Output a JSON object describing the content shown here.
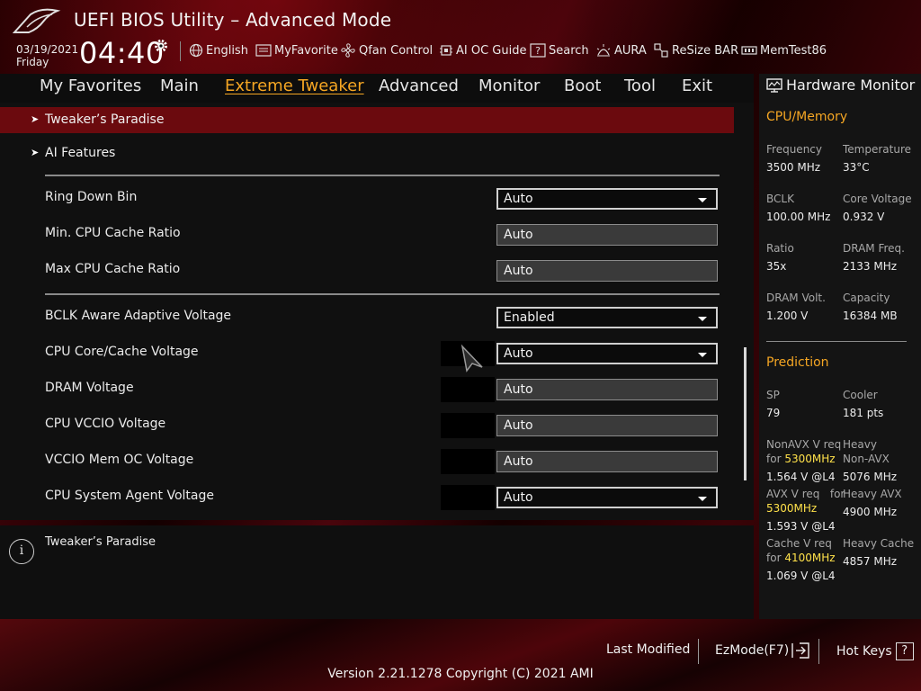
{
  "header": {
    "app_title": "UEFI BIOS Utility – Advanced Mode",
    "date": "03/19/2021",
    "day": "Friday",
    "time": "04:40",
    "tools": [
      {
        "label": "English",
        "icon": "globe-icon"
      },
      {
        "label": "MyFavorite",
        "icon": "favorite-icon"
      },
      {
        "label": "Qfan Control",
        "icon": "fan-icon"
      },
      {
        "label": "AI OC Guide",
        "icon": "ai-chip-icon"
      },
      {
        "label": "Search",
        "icon": "search-help-icon"
      },
      {
        "label": "AURA",
        "icon": "aura-icon"
      },
      {
        "label": "ReSize BAR",
        "icon": "resize-bar-icon"
      },
      {
        "label": "MemTest86",
        "icon": "memory-icon"
      }
    ]
  },
  "tabs": [
    {
      "label": "My Favorites",
      "active": false
    },
    {
      "label": "Main",
      "active": false
    },
    {
      "label": "Extreme Tweaker",
      "active": true
    },
    {
      "label": "Advanced",
      "active": false
    },
    {
      "label": "Monitor",
      "active": false
    },
    {
      "label": "Boot",
      "active": false
    },
    {
      "label": "Tool",
      "active": false
    },
    {
      "label": "Exit",
      "active": false
    }
  ],
  "sections": [
    {
      "label": "Tweaker’s Paradise",
      "highlighted": true
    },
    {
      "label": "AI Features",
      "highlighted": false
    }
  ],
  "settings": [
    {
      "label": "Ring Down Bin",
      "value": "Auto",
      "type": "dropdown"
    },
    {
      "label": "Min. CPU Cache Ratio",
      "value": "Auto",
      "type": "text"
    },
    {
      "label": "Max CPU Cache Ratio",
      "value": "Auto",
      "type": "text"
    },
    {
      "label": "BCLK Aware Adaptive Voltage",
      "value": "Enabled",
      "type": "dropdown"
    },
    {
      "label": "CPU Core/Cache Voltage",
      "value": "Auto",
      "type": "dropdown"
    },
    {
      "label": "DRAM Voltage",
      "value": "Auto",
      "type": "text"
    },
    {
      "label": "CPU VCCIO Voltage",
      "value": "Auto",
      "type": "text"
    },
    {
      "label": "VCCIO Mem OC Voltage",
      "value": "Auto",
      "type": "text"
    },
    {
      "label": "CPU System Agent Voltage",
      "value": "Auto",
      "type": "dropdown"
    }
  ],
  "help": {
    "text": "Tweaker’s Paradise"
  },
  "hw": {
    "title": "Hardware Monitor",
    "cpu_head": "CPU/Memory",
    "cpu": [
      {
        "label": "Frequency",
        "value": "3500 MHz"
      },
      {
        "label": "Temperature",
        "value": "33°C"
      },
      {
        "label": "BCLK",
        "value": "100.00 MHz"
      },
      {
        "label": "Core Voltage",
        "value": "0.932 V"
      },
      {
        "label": "Ratio",
        "value": "35x"
      },
      {
        "label": "DRAM Freq.",
        "value": "2133 MHz"
      },
      {
        "label": "DRAM Volt.",
        "value": "1.200 V"
      },
      {
        "label": "Capacity",
        "value": "16384 MB"
      }
    ],
    "pred_head": "Prediction",
    "sp_label": "SP",
    "sp_value": "79",
    "cooler_label": "Cooler",
    "cooler_value": "181 pts",
    "nonavx_label_a": "NonAVX V req",
    "nonavx_label_b": "for",
    "nonavx_freq": "5300MHz",
    "nonavx_value": "1.564 V @L4",
    "heavy_nonavx_label_a": "Heavy",
    "heavy_nonavx_label_b": "Non-AVX",
    "heavy_nonavx_value": "5076 MHz",
    "avx_label_a": "AVX V req",
    "avx_label_b": "for",
    "avx_freq": "5300MHz",
    "avx_value": "1.593 V @L4",
    "heavy_avx_label": "Heavy AVX",
    "heavy_avx_value": "4900 MHz",
    "cache_label_a": "Cache V req",
    "cache_label_b": "for",
    "cache_freq": "4100MHz",
    "cache_value": "1.069 V @L4",
    "heavy_cache_label": "Heavy Cache",
    "heavy_cache_value": "4857 MHz"
  },
  "footer": {
    "last_modified": "Last Modified",
    "ezmode": "EzMode(F7)",
    "ezmode_icon": "exit-arrow-icon",
    "hotkeys": "Hot Keys",
    "hotkeys_key": "?",
    "version": "Version 2.21.1278 Copyright (C) 2021 AMI"
  },
  "colors": {
    "accent": "#f5a623",
    "highlight_row": "#6b0a0e",
    "prediction_value": "#ffe14a"
  }
}
